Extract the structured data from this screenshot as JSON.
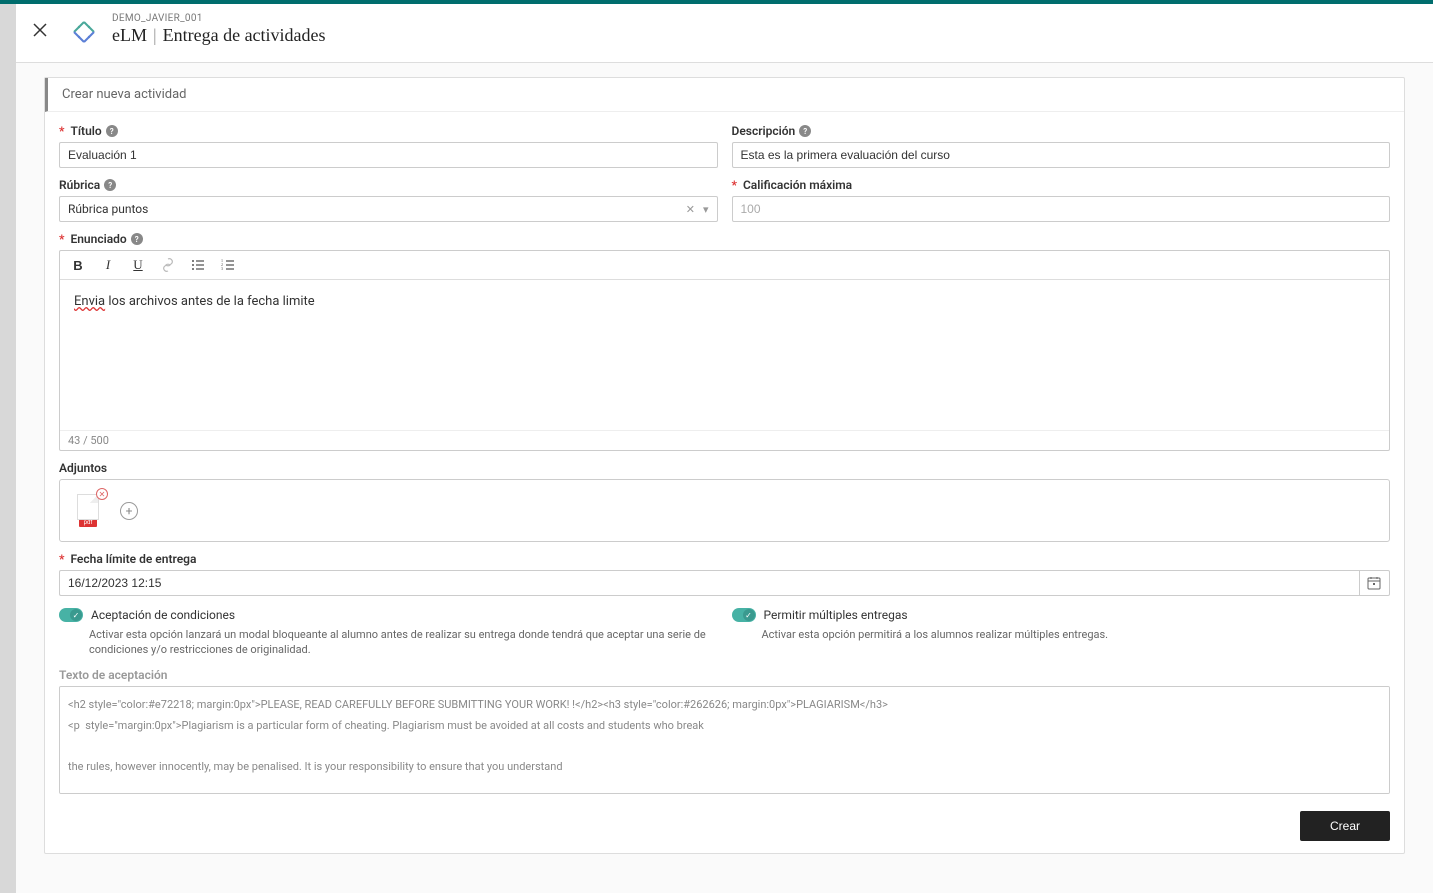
{
  "header": {
    "subtitle": "DEMO_JAVIER_001",
    "title_prefix": "eLM",
    "title": "Entrega de actividades"
  },
  "card": {
    "title": "Crear nueva actividad"
  },
  "form": {
    "titulo": {
      "label": "Título",
      "value": "Evaluación 1"
    },
    "descripcion": {
      "label": "Descripción",
      "value": "Esta es la primera evaluación del curso"
    },
    "rubrica": {
      "label": "Rúbrica",
      "value": "Rúbrica puntos"
    },
    "calificacion": {
      "label": "Calificación máxima",
      "placeholder": "100",
      "value": ""
    },
    "enunciado": {
      "label": "Enunciado",
      "content_pre": "Envia",
      "content_post": " los archivos antes de la fecha limite",
      "counter": "43 / 500"
    },
    "adjuntos": {
      "label": "Adjuntos",
      "file_type": "pdf"
    },
    "fecha": {
      "label": "Fecha límite de entrega",
      "value": "16/12/2023 12:15"
    },
    "aceptacion": {
      "label": "Aceptación de condiciones",
      "desc": "Activar esta opción lanzará un modal bloqueante al alumno antes de realizar su entrega donde tendrá que aceptar una serie de condiciones y/o restricciones de originalidad."
    },
    "multiples": {
      "label": "Permitir múltiples entregas",
      "desc": "Activar esta opción permitirá a los alumnos realizar múltiples entregas."
    },
    "texto_aceptacion": {
      "label": "Texto de aceptación",
      "value": "<h2 style=\"color:#e72218; margin:0px\">PLEASE, READ CAREFULLY BEFORE SUBMITTING YOUR WORK! !</h2><h3 style=\"color:#262626; margin:0px\">PLAGIARISM</h3>\n<p  style=\"margin:0px\">Plagiarism is a particular form of cheating. Plagiarism must be avoided at all costs and students who break\n\nthe rules, however innocently, may be penalised. It is your responsibility to ensure that you understand\n\ncorrect referencing practices. As a university level student, you are expected to use appropriate references\n\nthroughout and keep carefully detailed notes of all your sources of materials for material you have used in"
    }
  },
  "actions": {
    "crear": "Crear"
  }
}
